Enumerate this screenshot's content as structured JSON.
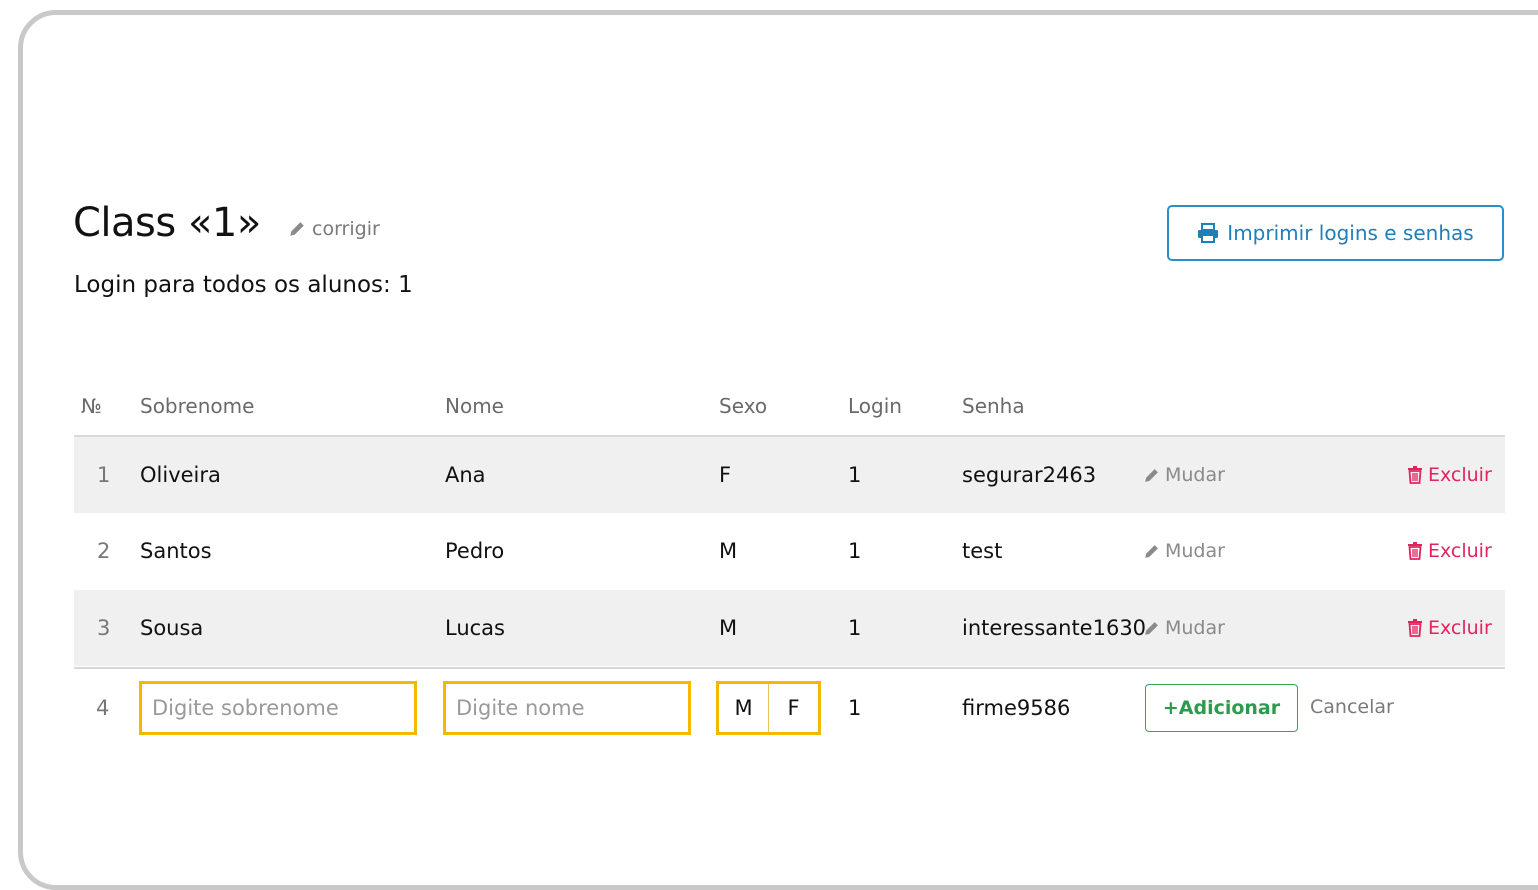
{
  "header": {
    "title": "Class «1»",
    "edit_label": "corrigir",
    "subtitle": "Login para todos os alunos: 1",
    "print_label": "Imprimir logins e senhas"
  },
  "table": {
    "columns": [
      "№",
      "Sobrenome",
      "Nome",
      "Sexo",
      "Login",
      "Senha"
    ],
    "rows": [
      {
        "num": "1",
        "surname": "Oliveira",
        "name": "Ana",
        "sex": "F",
        "login": "1",
        "password": "segurar2463",
        "change_label": "Mudar",
        "delete_label": "Excluir"
      },
      {
        "num": "2",
        "surname": "Santos",
        "name": "Pedro",
        "sex": "M",
        "login": "1",
        "password": "test",
        "change_label": "Mudar",
        "delete_label": "Excluir"
      },
      {
        "num": "3",
        "surname": "Sousa",
        "name": "Lucas",
        "sex": "M",
        "login": "1",
        "password": "interessante1630",
        "change_label": "Mudar",
        "delete_label": "Excluir"
      }
    ],
    "new_row": {
      "num": "4",
      "surname_placeholder": "Digite sobrenome",
      "name_placeholder": "Digite nome",
      "sex_options": [
        "M",
        "F"
      ],
      "login": "1",
      "password": "firme9586",
      "add_label": "+Adicionar",
      "cancel_label": "Cancelar"
    }
  },
  "colors": {
    "accent_blue": "#2a8fc9",
    "danger_red": "#e0245e",
    "success_green": "#3aa55a",
    "highlight_yellow": "#f5b800",
    "row_shade": "#f0f0f0"
  },
  "icons": [
    "pencil-icon",
    "printer-icon",
    "trash-icon"
  ]
}
